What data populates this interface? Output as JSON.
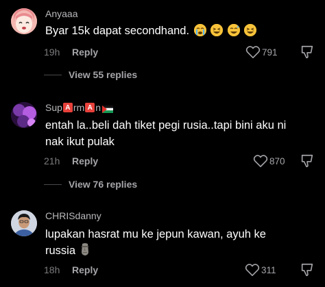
{
  "comments": [
    {
      "username": "Anyaaa",
      "text": "Byar 15k dapat secondhand.",
      "emojis": [
        "loudly-crying-face-icon",
        "grinning-squinting-face-icon",
        "grinning-sweat-face-icon",
        "grinning-squinting-face-icon"
      ],
      "time": "19h",
      "reply_label": "Reply",
      "likes": "791",
      "view_replies": "View 55 replies"
    },
    {
      "username_parts": [
        "Sup",
        "A",
        "rm",
        "A",
        "n"
      ],
      "text": "entah la..beli dah tiket pegi rusia..tapi bini aku ni nak ikut pulak",
      "time": "21h",
      "reply_label": "Reply",
      "likes": "870",
      "view_replies": "View 76 replies"
    },
    {
      "username": "CHRISdanny",
      "text": "lupakan hasrat mu ke jepun kawan, ayuh ke russia",
      "emojis": [
        "moai-icon"
      ],
      "time": "18h",
      "reply_label": "Reply",
      "likes": "311"
    }
  ],
  "colors": {
    "background": "#000000",
    "username": "#b9b9bd",
    "text": "#ffffff",
    "meta": "#7c7c80",
    "action": "#a5a5aa",
    "badge": "#e8413b"
  }
}
